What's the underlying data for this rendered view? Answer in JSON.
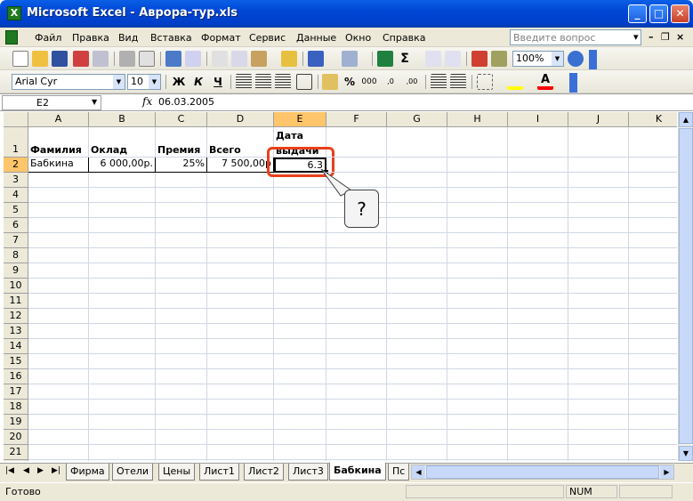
{
  "window": {
    "title": "Microsoft Excel - Аврора-тур.xls",
    "app_icon": "X",
    "minimize": "_",
    "maximize": "□",
    "close": "✕"
  },
  "menu": {
    "items": [
      "Файл",
      "Правка",
      "Вид",
      "Вставка",
      "Формат",
      "Сервис",
      "Данные",
      "Окно",
      "Справка"
    ],
    "help_placeholder": "Введите вопрос",
    "mdi_controls": [
      "▾",
      "–",
      "❐",
      "×"
    ]
  },
  "toolbar": {
    "zoom": "100%",
    "font_name": "Arial Cyr",
    "font_size": "10",
    "bold_label": "Ж",
    "italic_label": "К",
    "underline_label": "Ч",
    "percent_label": "%",
    "thousands_label": "000",
    "sum_label": "Σ",
    "font_color_label": "А"
  },
  "formula_bar": {
    "name_box": "E2",
    "fx": "fx",
    "content": "06.03.2005"
  },
  "grid": {
    "columns": [
      "A",
      "B",
      "C",
      "D",
      "E",
      "F",
      "G",
      "H",
      "I",
      "J",
      "K"
    ],
    "rows": [
      "1",
      "2",
      "3",
      "4",
      "5",
      "6",
      "7",
      "8",
      "9",
      "10",
      "11",
      "12",
      "13",
      "14",
      "15",
      "16",
      "17",
      "18",
      "19",
      "20",
      "21",
      "22"
    ],
    "row1": {
      "A": "Фамилия",
      "B": "Оклад",
      "C": "Премия",
      "D": "Всего",
      "E_line1": "Дата",
      "E_line2": "выдачи"
    },
    "row2": {
      "A": "Бабкина",
      "B": "6 000,00р.",
      "C": "25%",
      "D": "7 500,00р",
      "E": "6.3"
    }
  },
  "callout": {
    "text": "?"
  },
  "sheet_tabs": {
    "tabs": [
      "Фирма",
      "Отели",
      "Цены",
      "Лист1",
      "Лист2",
      "Лист3",
      "Бабкина",
      "Пс"
    ],
    "active": "Бабкина"
  },
  "status": {
    "ready": "Готово",
    "num": "NUM"
  },
  "colors": {
    "titlebar": "#0046d5",
    "highlight_red": "#e8401c",
    "selected_header": "#ffc56a"
  }
}
